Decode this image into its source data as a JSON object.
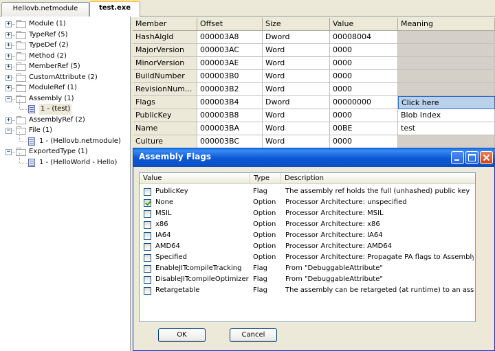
{
  "tabs": [
    {
      "label": "Hellovb.netmodule",
      "active": false
    },
    {
      "label": "test.exe",
      "active": true
    }
  ],
  "tree": {
    "nodes": [
      {
        "label": "Module (1)",
        "expander": "+"
      },
      {
        "label": "TypeRef (5)",
        "expander": "+"
      },
      {
        "label": "TypeDef (2)",
        "expander": "+"
      },
      {
        "label": "Method (2)",
        "expander": "+"
      },
      {
        "label": "MemberRef (5)",
        "expander": "+"
      },
      {
        "label": "CustomAttribute (2)",
        "expander": "+"
      },
      {
        "label": "ModuleRef (1)",
        "expander": "+"
      },
      {
        "label": "Assembly (1)",
        "expander": "−"
      },
      {
        "label": "1 - (test)",
        "child": true
      },
      {
        "label": "AssemblyRef (2)",
        "expander": "+"
      },
      {
        "label": "File (1)",
        "expander": "−"
      },
      {
        "label": "1 - (Hellovb.netmodule)",
        "child": true
      },
      {
        "label": "ExportedType (1)",
        "expander": "−"
      },
      {
        "label": "1 - (HelloWorld - Hello)",
        "child": true
      }
    ]
  },
  "grid": {
    "headers": [
      "Member",
      "Offset",
      "Size",
      "Value",
      "Meaning"
    ],
    "rows": [
      {
        "member": "HashAlgId",
        "offset": "000003A8",
        "size": "Dword",
        "value": "00008004",
        "meaning": ""
      },
      {
        "member": "MajorVersion",
        "offset": "000003AC",
        "size": "Word",
        "value": "0000",
        "meaning": ""
      },
      {
        "member": "MinorVersion",
        "offset": "000003AE",
        "size": "Word",
        "value": "0000",
        "meaning": ""
      },
      {
        "member": "BuildNumber",
        "offset": "000003B0",
        "size": "Word",
        "value": "0000",
        "meaning": ""
      },
      {
        "member": "RevisionNum...",
        "offset": "000003B2",
        "size": "Word",
        "value": "0000",
        "meaning": ""
      },
      {
        "member": "Flags",
        "offset": "000003B4",
        "size": "Dword",
        "value": "00000000",
        "meaning": "Click here"
      },
      {
        "member": "PublicKey",
        "offset": "000003B8",
        "size": "Word",
        "value": "0000",
        "meaning": "Blob Index"
      },
      {
        "member": "Name",
        "offset": "000003BA",
        "size": "Word",
        "value": "00BE",
        "meaning": "test"
      },
      {
        "member": "Culture",
        "offset": "000003BC",
        "size": "Word",
        "value": "0000",
        "meaning": ""
      }
    ]
  },
  "dialog": {
    "title": "Assembly Flags",
    "columns": [
      "Value",
      "Type",
      "Description"
    ],
    "items": [
      {
        "value": "PublicKey",
        "type": "Flag",
        "description": "The assembly ref holds the full (unhashed) public key",
        "checked": false
      },
      {
        "value": "None",
        "type": "Option",
        "description": "Processor Architecture: unspecified",
        "checked": true
      },
      {
        "value": "MSIL",
        "type": "Option",
        "description": "Processor Architecture: MSIL",
        "checked": false
      },
      {
        "value": "x86",
        "type": "Option",
        "description": "Processor Architecture: x86",
        "checked": false
      },
      {
        "value": "IA64",
        "type": "Option",
        "description": "Processor Architecture: IA64",
        "checked": false
      },
      {
        "value": "AMD64",
        "type": "Option",
        "description": "Processor Architecture: AMD64",
        "checked": false
      },
      {
        "value": "Specified",
        "type": "Option",
        "description": "Processor Architecture: Propagate PA flags to AssemblyR...",
        "checked": false
      },
      {
        "value": "EnableJITcompileTracking",
        "type": "Flag",
        "description": "From \"DebuggableAttribute\"",
        "checked": false
      },
      {
        "value": "DisableJITcompileOptimizer",
        "type": "Flag",
        "description": "From \"DebuggableAttribute\"",
        "checked": false
      },
      {
        "value": "Retargetable",
        "type": "Flag",
        "description": "The assembly can be retargeted (at runtime) to an assem...",
        "checked": false
      }
    ],
    "ok_label": "OK",
    "cancel_label": "Cancel"
  }
}
